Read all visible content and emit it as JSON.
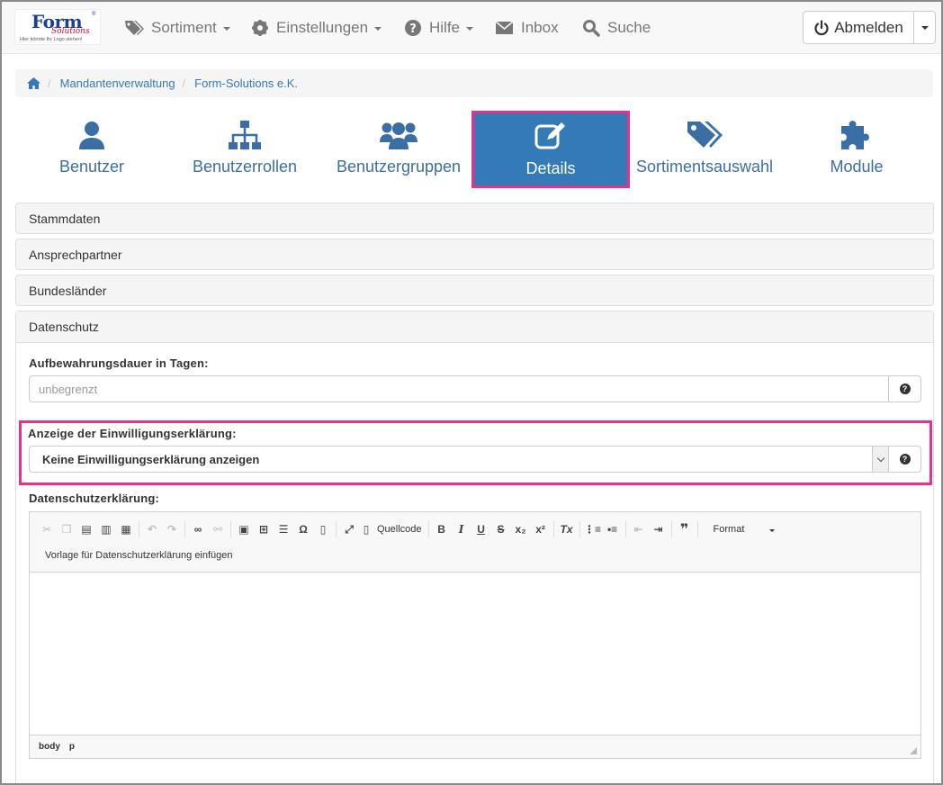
{
  "logo": {
    "brand": "Form",
    "sub": "Solutions",
    "tagline": "Hier könnte Ihr Logo stehen!",
    "reg": "®"
  },
  "nav": {
    "items": [
      {
        "label": "Sortiment",
        "icon": "tags-icon",
        "dropdown": true
      },
      {
        "label": "Einstellungen",
        "icon": "gear-icon",
        "dropdown": true
      },
      {
        "label": "Hilfe",
        "icon": "question-circle-icon",
        "dropdown": true
      },
      {
        "label": "Inbox",
        "icon": "envelope-icon",
        "dropdown": false
      },
      {
        "label": "Suche",
        "icon": "search-icon",
        "dropdown": false
      }
    ],
    "logout_label": "Abmelden"
  },
  "breadcrumb": {
    "items": [
      "Mandantenverwaltung",
      "Form-Solutions e.K."
    ]
  },
  "tabs": [
    {
      "label": "Benutzer",
      "icon": "user-icon"
    },
    {
      "label": "Benutzerrollen",
      "icon": "sitemap-icon"
    },
    {
      "label": "Benutzergruppen",
      "icon": "users-icon"
    },
    {
      "label": "Details",
      "icon": "edit-icon",
      "active": true
    },
    {
      "label": "Sortimentsauswahl",
      "icon": "tags-icon"
    },
    {
      "label": "Module",
      "icon": "puzzle-icon"
    }
  ],
  "panels": {
    "stammdaten": "Stammdaten",
    "ansprechpartner": "Ansprechpartner",
    "bundeslaender": "Bundesländer",
    "datenschutz": "Datenschutz"
  },
  "form": {
    "retention_label": "Aufbewahrungsdauer in Tagen:",
    "retention_placeholder": "unbegrenzt",
    "consent_label": "Anzeige der Einwilligungserklärung:",
    "consent_value": "Keine Einwilligungserklärung anzeigen",
    "privacy_label": "Datenschutzerklärung:"
  },
  "editor": {
    "source_label": "Quellcode",
    "format_label": "Format",
    "template_label": "Vorlage für Datenschutzerklärung einfügen",
    "path": [
      "body",
      "p"
    ]
  },
  "colors": {
    "accent": "#337ab7",
    "highlight": "#e8318b",
    "tab_text": "#3a6ea5"
  }
}
